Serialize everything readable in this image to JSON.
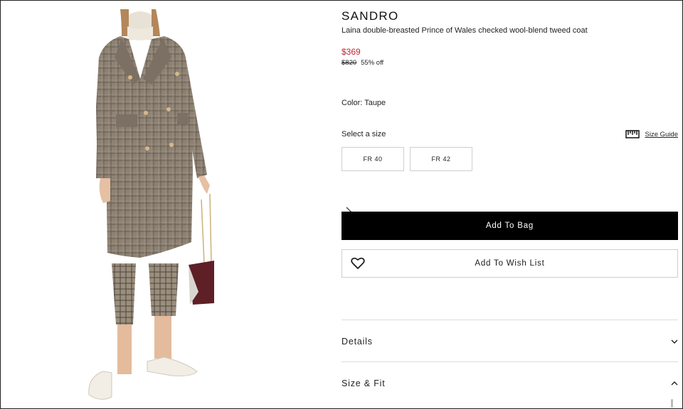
{
  "product": {
    "brand": "SANDRO",
    "name": "Laina double-breasted Prince of Wales checked wool-blend tweed coat",
    "price": "$369",
    "original_price": "$820",
    "discount": "55% off",
    "color_text": "Color: Taupe"
  },
  "sizes": {
    "label": "Select a size",
    "guide_label": "Size Guide",
    "options": [
      "FR 40",
      "FR 42"
    ]
  },
  "actions": {
    "add_to_bag": "Add To Bag",
    "add_to_wishlist": "Add To Wish List"
  },
  "accordions": {
    "details": "Details",
    "size_fit": "Size & Fit"
  },
  "colors": {
    "accent_price": "#c0262d",
    "button_dark": "#000000"
  },
  "icons": {
    "next": "chevron-right-icon",
    "ruler": "ruler-icon",
    "heart": "heart-icon",
    "details_toggle": "chevron-down-icon",
    "size_fit_toggle": "chevron-up-icon"
  }
}
